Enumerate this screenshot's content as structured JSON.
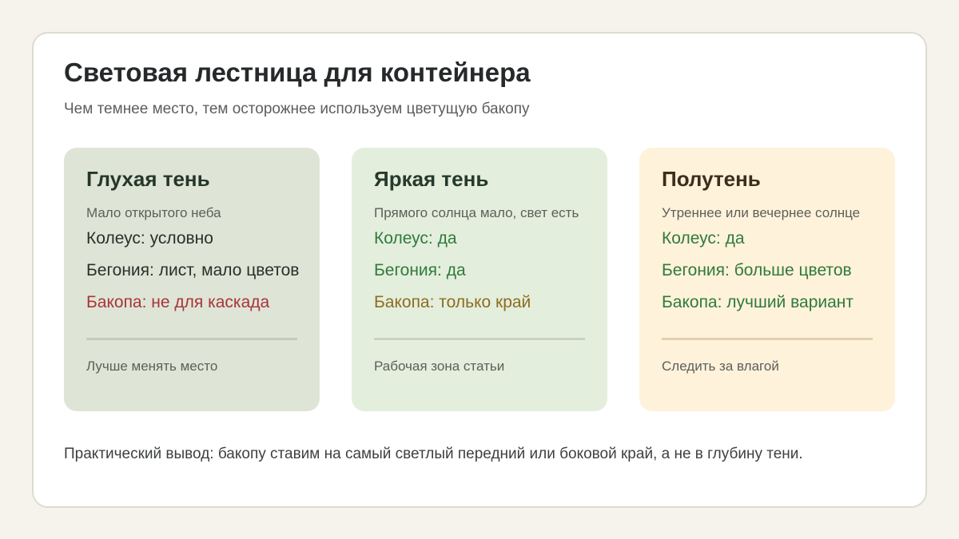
{
  "colors": {
    "page_background": "#f5f3ec",
    "panel_background": "#ffffff",
    "card_deep_shade": "#dfe5d6",
    "card_bright_shade": "#e4eedd",
    "card_partial_shade": "#fff2da",
    "status_neutral": "#2b2f2c",
    "status_yes": "#2f7a3c",
    "status_caution": "#8c6d1f",
    "status_no": "#a8343a"
  },
  "header": {
    "title": "Световая лестница для контейнера",
    "subtitle": "Чем темнее место, тем осторожнее используем цветущую бакопу"
  },
  "cards": [
    {
      "title": "Глухая тень",
      "subtitle": "Мало открытого неба",
      "lines": [
        {
          "text": "Колеус: условно",
          "color": "#2b2f2c"
        },
        {
          "text": "Бегония: лист, мало цветов",
          "color": "#2b2f2c"
        },
        {
          "text": "Бакопа: не для каскада",
          "color": "#a8343a"
        }
      ],
      "note": "Лучше менять место"
    },
    {
      "title": "Яркая тень",
      "subtitle": "Прямого солнца мало, свет есть",
      "lines": [
        {
          "text": "Колеус: да",
          "color": "#2f7a3c"
        },
        {
          "text": "Бегония: да",
          "color": "#2f7a3c"
        },
        {
          "text": "Бакопа: только край",
          "color": "#8c6d1f"
        }
      ],
      "note": "Рабочая зона статьи"
    },
    {
      "title": "Полутень",
      "subtitle": "Утреннее или вечернее солнце",
      "lines": [
        {
          "text": "Колеус: да",
          "color": "#2f7a3c"
        },
        {
          "text": "Бегония: больше цветов",
          "color": "#2f7a3c"
        },
        {
          "text": "Бакопа: лучший вариант",
          "color": "#2f7a3c"
        }
      ],
      "note": "Следить за влагой"
    }
  ],
  "footer": {
    "text": "Практический вывод: бакопу ставим на самый светлый передний или боковой край, а не в глубину тени."
  }
}
